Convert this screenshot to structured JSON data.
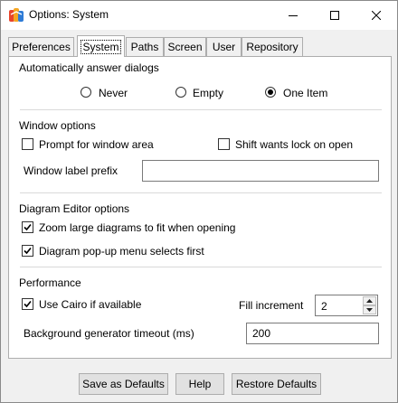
{
  "window": {
    "title": "Options: System",
    "controls": {
      "minimize": "minimize-icon",
      "maximize": "maximize-icon",
      "close": "close-icon"
    }
  },
  "tabs": [
    {
      "label": "Preferences",
      "active": false
    },
    {
      "label": "System",
      "active": true
    },
    {
      "label": "Paths",
      "active": false
    },
    {
      "label": "Screen",
      "active": false
    },
    {
      "label": "User",
      "active": false
    },
    {
      "label": "Repository",
      "active": false
    }
  ],
  "auto_answer": {
    "heading": "Automatically answer dialogs",
    "options": [
      {
        "label": "Never",
        "checked": false
      },
      {
        "label": "Empty",
        "checked": false
      },
      {
        "label": "One Item",
        "checked": true
      }
    ]
  },
  "window_options": {
    "heading": "Window options",
    "prompt_area": {
      "label": "Prompt for window area",
      "checked": false
    },
    "shift_lock": {
      "label": "Shift wants lock on open",
      "checked": false
    },
    "prefix": {
      "label": "Window label prefix",
      "value": ""
    }
  },
  "diagram_editor": {
    "heading": "Diagram Editor options",
    "zoom_fit": {
      "label": "Zoom large diagrams to fit when opening",
      "checked": true
    },
    "popup_first": {
      "label": "Diagram pop-up menu selects first",
      "checked": true
    }
  },
  "performance": {
    "heading": "Performance",
    "use_cairo": {
      "label": "Use Cairo if available",
      "checked": true
    },
    "fill_increment": {
      "label": "Fill increment",
      "value": "2"
    },
    "bg_timeout": {
      "label": "Background generator timeout (ms)",
      "value": "200"
    }
  },
  "buttons": {
    "save_defaults": "Save as Defaults",
    "help": "Help",
    "restore_defaults": "Restore Defaults"
  }
}
